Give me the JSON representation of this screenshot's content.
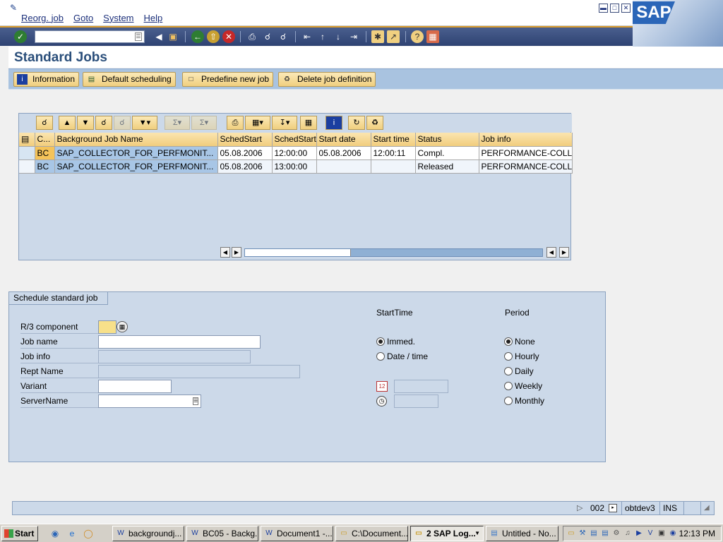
{
  "menubar": {
    "items": [
      "Reorg. job",
      "Goto",
      "System",
      "Help"
    ],
    "window_controls": [
      "minimize-icon",
      "restore-icon",
      "close-icon"
    ],
    "logo_text": "SAP"
  },
  "toolbar": {
    "command_field_value": "",
    "icons": [
      "enter-icon",
      "back-arrow-icon",
      "save-icon",
      "back-icon",
      "exit-icon",
      "cancel-icon",
      "print-icon",
      "find-icon",
      "find-next-icon",
      "first-page-icon",
      "previous-page-icon",
      "next-page-icon",
      "last-page-icon",
      "create-session-icon",
      "shortcut-icon",
      "help-icon",
      "layout-icon"
    ]
  },
  "title": "Standard Jobs",
  "app_buttons": [
    {
      "label": "Information",
      "icon": "info-icon"
    },
    {
      "label": "Default scheduling",
      "icon": "schedule-icon"
    },
    {
      "label": "Predefine new job",
      "icon": "document-icon"
    },
    {
      "label": "Delete job definition",
      "icon": "trash-icon"
    }
  ],
  "grid": {
    "columns": [
      "C...",
      "Background Job Name",
      "SchedStart",
      "SchedStart",
      "Start date",
      "Start time",
      "Status",
      "Job info"
    ],
    "rows": [
      [
        "BC",
        "SAP_COLLECTOR_FOR_PERFMONIT...",
        "05.08.2006",
        "12:00:00",
        "05.08.2006",
        "12:00:11",
        "Compl.",
        "PERFORMANCE-COLL"
      ],
      [
        "BC",
        "SAP_COLLECTOR_FOR_PERFMONIT...",
        "05.08.2006",
        "13:00:00",
        "",
        "",
        "Released",
        "PERFORMANCE-COLL"
      ]
    ]
  },
  "schedule": {
    "tab_label": "Schedule standard job",
    "fields": {
      "r3_component": "R/3 component",
      "job_name": "Job name",
      "job_info": "Job info",
      "rept_name": "Rept Name",
      "variant": "Variant",
      "server_name": "ServerName"
    },
    "start_time_heading": "StartTime",
    "start_options": [
      "Immed.",
      "Date / time"
    ],
    "start_selected": "Immed.",
    "period_heading": "Period",
    "period_options": [
      "None",
      "Hourly",
      "Daily",
      "Weekly",
      "Monthly"
    ],
    "period_selected": "None"
  },
  "statusbar": {
    "session": "002",
    "server": "obtdev3",
    "mode": "INS"
  },
  "taskbar": {
    "start_label": "Start",
    "tasks": [
      {
        "label": "backgroundj...",
        "icon": "word-icon",
        "active": false
      },
      {
        "label": "BC05 - Backg...",
        "icon": "word-icon",
        "active": false
      },
      {
        "label": "Document1 -...",
        "icon": "word-icon",
        "active": false
      },
      {
        "label": "C:\\Document...",
        "icon": "folder-icon",
        "active": false
      },
      {
        "label": "2 SAP Log...",
        "icon": "sap-icon",
        "active": true
      },
      {
        "label": "Untitled - No...",
        "icon": "notepad-icon",
        "active": false
      }
    ],
    "clock": "12:13 PM"
  },
  "colors": {
    "title": "#2a4e7a",
    "toolbar": "#2e4272",
    "panel": "#ccd9e9",
    "button": "#f0cf7e"
  }
}
